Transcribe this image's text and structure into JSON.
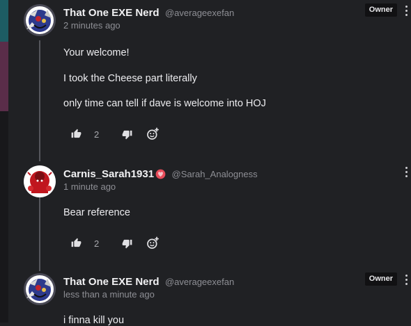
{
  "comments": [
    {
      "username": "That One EXE Nerd",
      "handle": "@averageexefan",
      "time": "2 minutes ago",
      "badge": "Owner",
      "lines": [
        "Your welcome!",
        "I took the Cheese part literally",
        "only time can tell if dave is welcome into HOJ"
      ],
      "likes": "2"
    },
    {
      "username": "Carnis_Sarah1931",
      "handle": "@Sarah_Analogness",
      "time": "1 minute ago",
      "lines": [
        "Bear reference"
      ],
      "likes": "2"
    },
    {
      "username": "That One EXE Nerd",
      "handle": "@averageexefan",
      "time": "less than a minute ago",
      "badge": "Owner",
      "lines": [
        "i finna kill you"
      ]
    }
  ],
  "icons": {
    "like": "thumbs-up-icon",
    "dislike": "thumbs-down-icon",
    "react": "add-reaction-icon",
    "more": "more-options-icon",
    "username_badge": "heart-badge-icon"
  },
  "colors": {
    "background": "#202124",
    "text": "#ececef",
    "muted": "#8e8f95",
    "owner_badge_bg": "#111113",
    "heart_badge": "#e74c5a"
  }
}
